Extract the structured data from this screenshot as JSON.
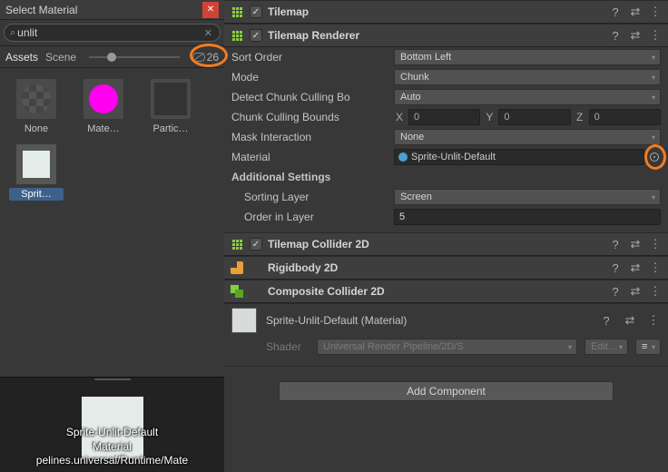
{
  "left_panel": {
    "title": "Select Material",
    "search_value": "unlit",
    "tabs": {
      "assets": "Assets",
      "scene": "Scene"
    },
    "hidden_count": "26",
    "items": {
      "none": "None",
      "mate": "Mate…",
      "partic": "Partic…",
      "sprit": "Sprit…"
    },
    "preview": {
      "line1": "Sprite-Unlit-Default",
      "line2": "Material",
      "line3": "pelines.universal/Runtime/Mate"
    }
  },
  "inspector": {
    "tilemap": "Tilemap",
    "tilemap_renderer": "Tilemap Renderer",
    "props": {
      "sort_order_label": "Sort Order",
      "sort_order_value": "Bottom Left",
      "mode_label": "Mode",
      "mode_value": "Chunk",
      "detect_label": "Detect Chunk Culling Bo",
      "detect_value": "Auto",
      "bounds_label": "Chunk Culling Bounds",
      "bounds_x": "0",
      "bounds_y": "0",
      "bounds_z": "0",
      "mask_label": "Mask Interaction",
      "mask_value": "None",
      "material_label": "Material",
      "material_value": "Sprite-Unlit-Default",
      "additional": "Additional Settings",
      "sorting_layer_label": "Sorting Layer",
      "sorting_layer_value": "Screen",
      "order_label": "Order in Layer",
      "order_value": "5"
    },
    "collider": "Tilemap Collider 2D",
    "rigidbody": "Rigidbody 2D",
    "composite": "Composite Collider 2D",
    "material_footer_name": "Sprite-Unlit-Default (Material)",
    "shader_label": "Shader",
    "shader_value": "Universal Render Pipeline/2D/S",
    "edit_btn": "Edit…",
    "add_component": "Add Component",
    "vec_x": "X",
    "vec_y": "Y",
    "vec_z": "Z"
  }
}
